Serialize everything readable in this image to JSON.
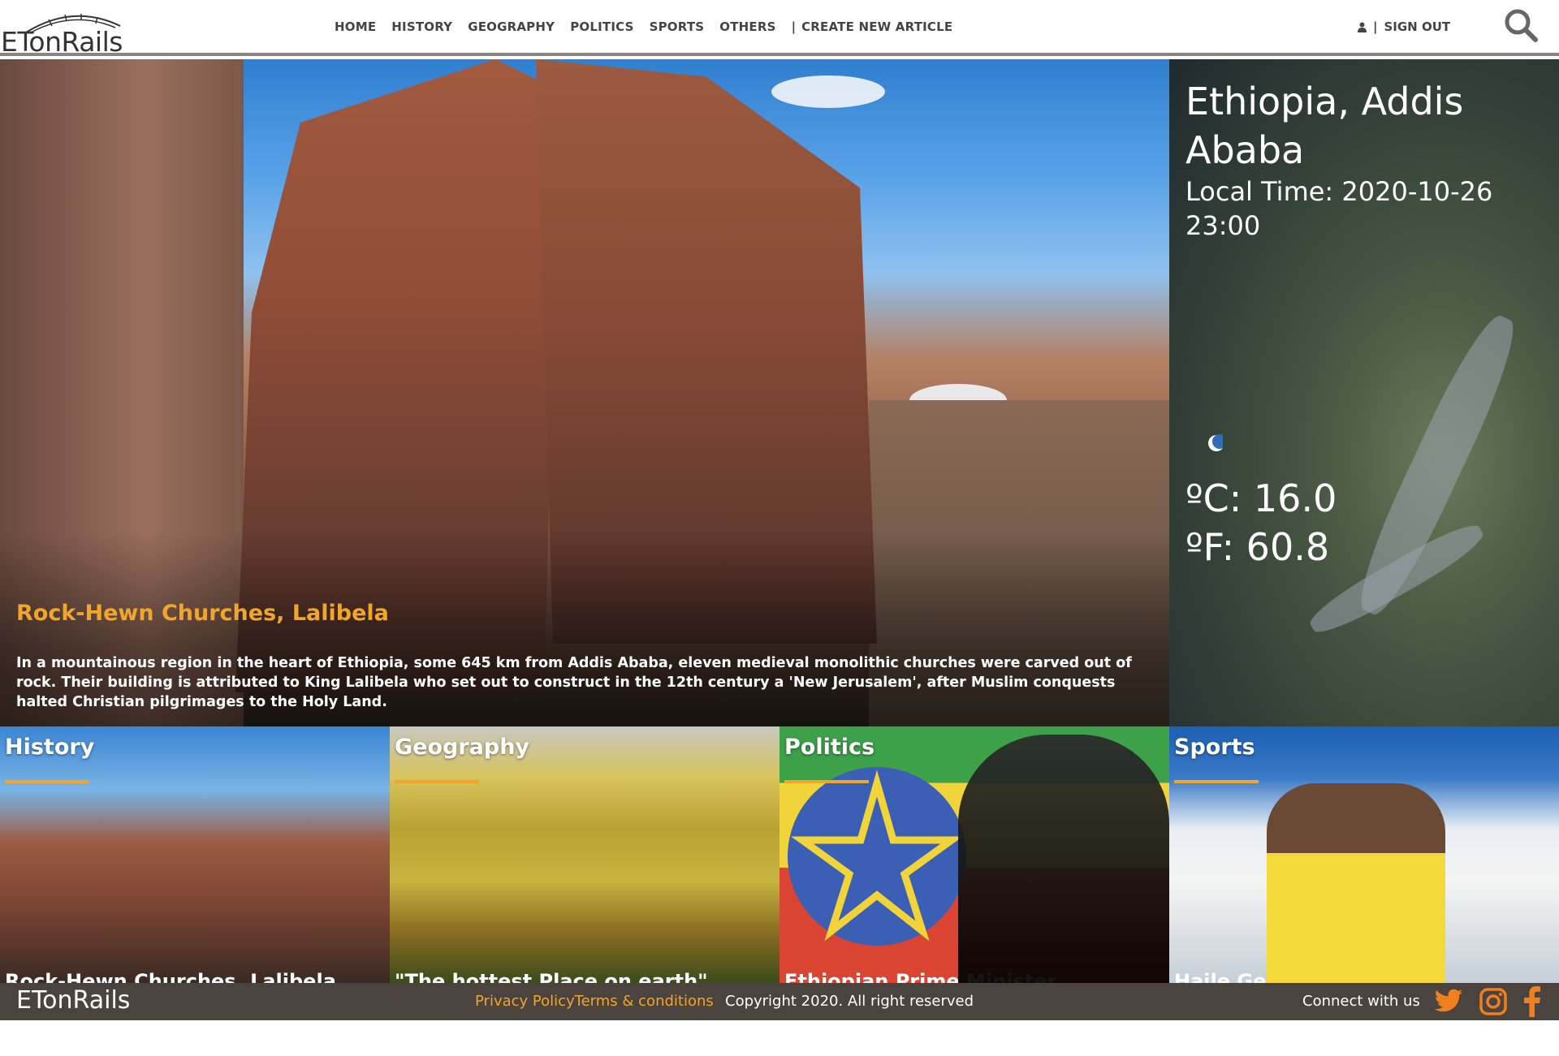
{
  "header": {
    "logo": "ETonRails",
    "nav": [
      {
        "label": "HOME"
      },
      {
        "label": "HISTORY"
      },
      {
        "label": "GEOGRAPHY"
      },
      {
        "label": "POLITICS"
      },
      {
        "label": "SPORTS"
      },
      {
        "label": "OTHERS"
      }
    ],
    "separator": "|",
    "create_label": "CREATE NEW ARTICLE",
    "user_separator": "|",
    "signout_label": "SIGN OUT"
  },
  "hero": {
    "title": "Rock-Hewn Churches, Lalibela",
    "description": "In a mountainous region in the heart of Ethiopia, some 645 km from Addis Ababa, eleven medieval monolithic churches were carved out of rock. Their building is attributed to King Lalibela who set out to construct in the 12th century a 'New Jerusalem', after Muslim conquests halted Christian pilgrimages to the Holy Land."
  },
  "weather": {
    "city": "Ethiopia, Addis Ababa",
    "local_time": "Local Time: 2020-10-26 23:00",
    "celsius": "ºC: 16.0",
    "fahrenheit": "ºF: 60.8",
    "icon": "moon-icon"
  },
  "categories": [
    {
      "title": "History",
      "caption": "Rock-Hewn Churches, Lalibela"
    },
    {
      "title": "Geography",
      "caption": "\"The hottest Place on earth\""
    },
    {
      "title": "Politics",
      "caption": "Ethiopian Prime Minister"
    },
    {
      "title": "Sports",
      "caption": "Haile Gebrselassie"
    }
  ],
  "footer": {
    "logo": "ETonRails",
    "privacy": "Privacy Policy",
    "terms": "Terms & conditions",
    "copyright": "Copyright 2020. All right reserved",
    "connect": "Connect with us"
  },
  "colors": {
    "accent": "#f0a62a",
    "footer_bg": "#4b433e",
    "header_border": "#8a8480"
  }
}
